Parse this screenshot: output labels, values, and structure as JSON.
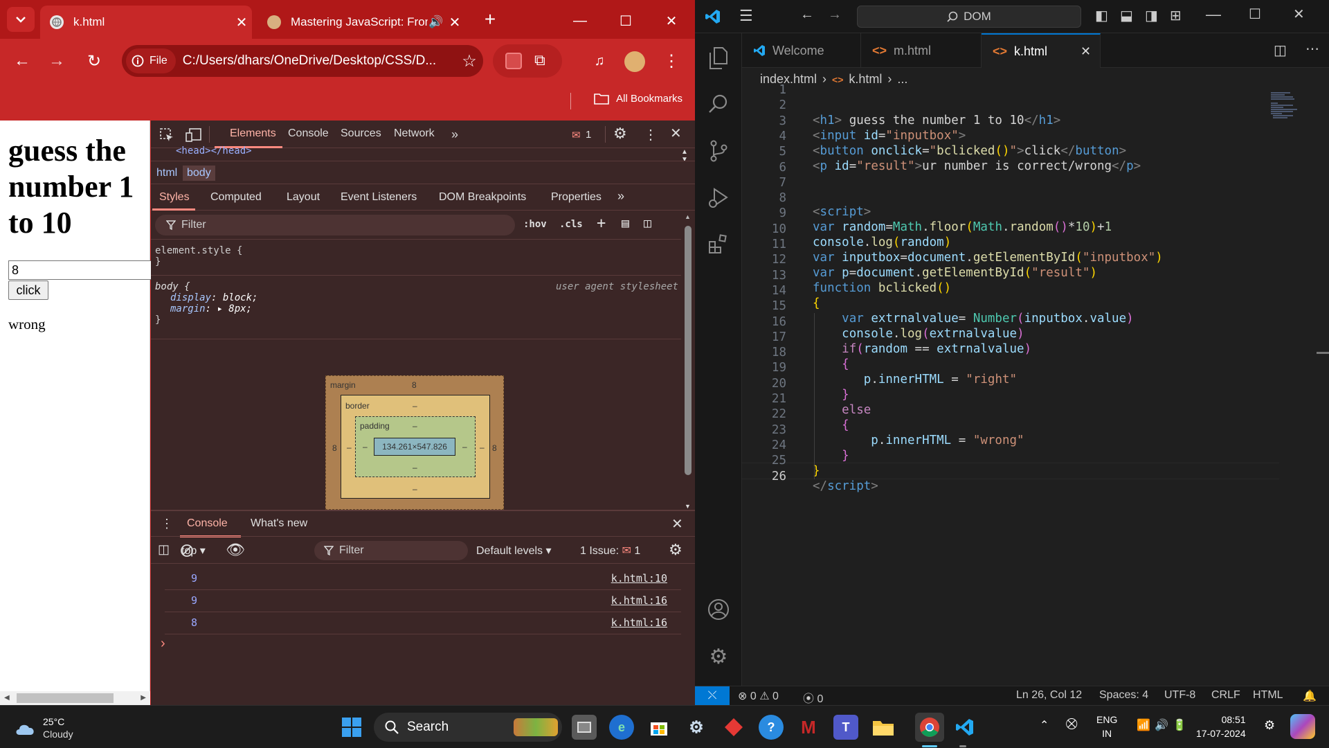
{
  "chrome": {
    "tabs": [
      {
        "title": "k.html"
      },
      {
        "title": "Mastering JavaScript: From"
      }
    ],
    "omnibox": {
      "chip": "File",
      "url": "C:/Users/dhars/OneDrive/Desktop/CSS/D..."
    },
    "bookmarks": {
      "all_label": "All Bookmarks"
    },
    "colors": {
      "frame": "#b71c1c",
      "toolbar": "#c72828"
    }
  },
  "page": {
    "heading": "guess the number 1 to 10",
    "input_value": "8",
    "button_label": "click",
    "result_text": "wrong"
  },
  "devtools": {
    "tabs": [
      "Elements",
      "Console",
      "Sources",
      "Network"
    ],
    "issues_count": "1",
    "dom_snippet": "<head></head>",
    "breadcrumbs": [
      "html",
      "body"
    ],
    "subtabs": [
      "Styles",
      "Computed",
      "Layout",
      "Event Listeners",
      "DOM Breakpoints",
      "Properties"
    ],
    "filter_placeholder": "Filter",
    "hov": ":hov",
    "cls": ".cls",
    "rules": {
      "element_style": "element.style {",
      "close_brace": "}",
      "body_selector": "body {",
      "source": "user agent stylesheet",
      "display_prop": "display",
      "display_val": "block;",
      "margin_prop": "margin",
      "margin_val": "8px;"
    },
    "box_model": {
      "margin_label": "margin",
      "margin_top": "8",
      "margin_left": "8",
      "margin_right": "8",
      "border_label": "border",
      "border_top": "–",
      "border_left": "–",
      "border_right": "–",
      "border_bottom": "–",
      "padding_label": "padding",
      "padding_top": "–",
      "padding_left": "–",
      "padding_right": "–",
      "padding_bottom": "–",
      "content": "134.261×547.826"
    },
    "drawer": {
      "console_tab": "Console",
      "whats_new": "What's new"
    },
    "console_toolbar": {
      "context": "top",
      "filter_placeholder": "Filter",
      "levels": "Default levels",
      "issues_label": "1 Issue:",
      "issues_count": "1"
    },
    "logs": [
      {
        "value": "9",
        "source": "k.html:10"
      },
      {
        "value": "9",
        "source": "k.html:16"
      },
      {
        "value": "8",
        "source": "k.html:16"
      }
    ],
    "prompt": "›"
  },
  "vscode": {
    "search": "DOM",
    "tabs": [
      {
        "label": "Welcome"
      },
      {
        "label": "m.html"
      },
      {
        "label": "k.html"
      }
    ],
    "breadcrumb": [
      "index.html",
      "k.html",
      "..."
    ],
    "status": {
      "errors": "0",
      "warnings": "0",
      "ports": "0",
      "position": "Ln 26, Col 12",
      "spaces": "Spaces: 4",
      "encoding": "UTF-8",
      "eol": "CRLF",
      "language": "HTML"
    },
    "line_numbers": [
      "1",
      "2",
      "3",
      "4",
      "5",
      "6",
      "7",
      "8",
      "9",
      "10",
      "11",
      "12",
      "13",
      "14",
      "15",
      "16",
      "17",
      "18",
      "19",
      "20",
      "21",
      "22",
      "23",
      "24",
      "25",
      "26"
    ]
  },
  "taskbar": {
    "weather_temp": "25°C",
    "weather_desc": "Cloudy",
    "search_label": "Search",
    "lang": "ENG",
    "region": "IN",
    "time": "08:51",
    "date": "17-07-2024"
  }
}
